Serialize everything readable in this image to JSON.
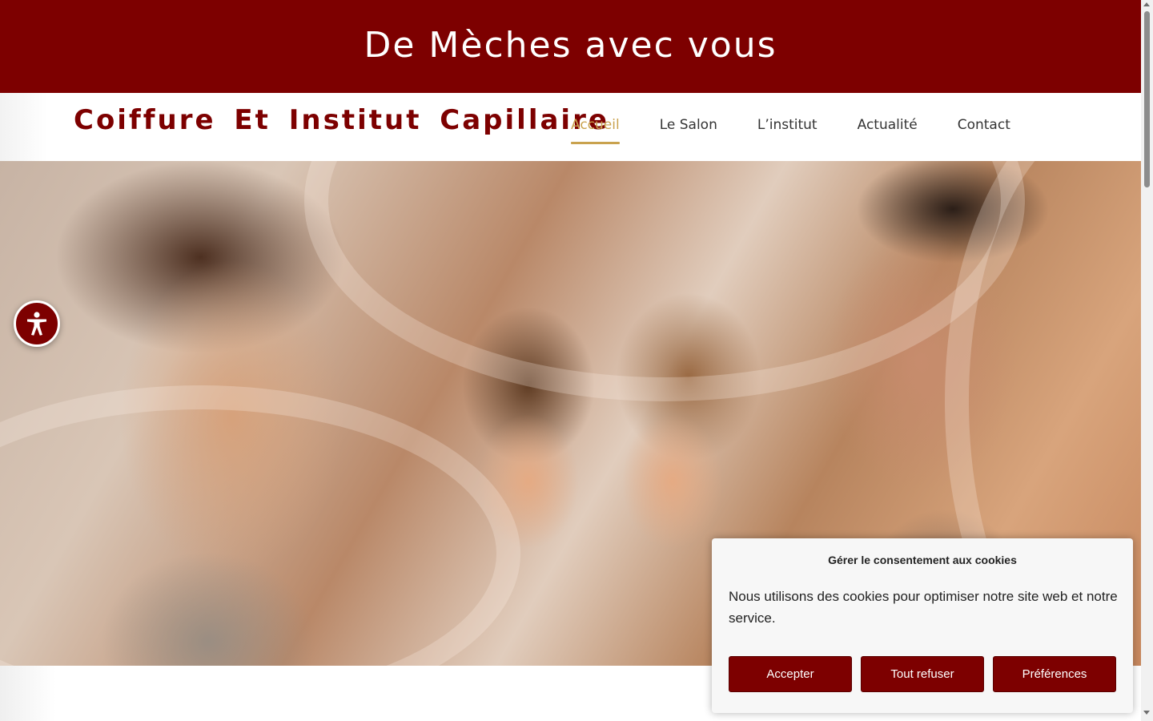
{
  "topbar": {
    "title": "De Mèches avec vous"
  },
  "header": {
    "site_title": "Coiffure Et Institut Capillaire",
    "nav": [
      {
        "label": "Accueil",
        "active": true
      },
      {
        "label": "Le Salon",
        "active": false
      },
      {
        "label": "L’institut",
        "active": false
      },
      {
        "label": "Actualité",
        "active": false
      },
      {
        "label": "Contact",
        "active": false
      }
    ]
  },
  "hero": {
    "image": "hero-photo-woman-children-man-hair-swirl-background"
  },
  "accessibility": {
    "icon": "accessibility-person-icon"
  },
  "cookie_banner": {
    "title": "Gérer le consentement aux cookies",
    "text": "Nous utilisons des cookies pour optimiser notre site web et notre service.",
    "buttons": {
      "accept": "Accepter",
      "refuse": "Tout refuser",
      "preferences": "Préférences"
    }
  },
  "colors": {
    "brand": "#7d0000",
    "accent": "#c9a24e",
    "nav_text": "#333333"
  }
}
